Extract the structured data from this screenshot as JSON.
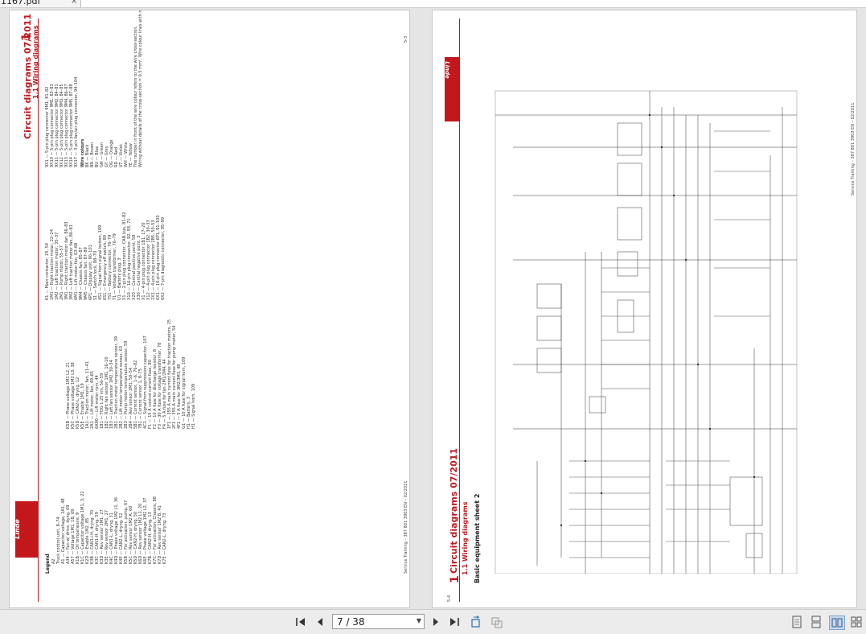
{
  "tab": {
    "title": "1167.pdf",
    "close": "×"
  },
  "left_page": {
    "header": {
      "title": "Circuit diagrams 07/2011",
      "chapter": "1",
      "section": "1.1 Wiring diagrams"
    },
    "legend_title": "Legend",
    "col1": [
      "A2",
      "Truck control unit, 8–74",
      "A1 — Capacitor voltage, 2A1, 48",
      "A34 — Fan w/ drive, dyng. 69",
      "A57 — Voltage 1M1, 1B, 69",
      "K1B — Oil temperature, 9",
      "K1C — Capacitor voltage 1M1, 3, 22",
      "K2D — Enable 1M2, 85",
      "K3B — CAN1+H, dryng. 70",
      "K3C — CAN1-H, dryng. 59",
      "K3D — Rev sensor 2M1, 27",
      "K3E — Rev sensor 2M1, 27",
      "K4C — CAN1-L, dryng. 31",
      "K4D — Phase voltage 1M2 L1, 36",
      "K4E — CAN2-L, dryng. 52",
      "K5B — For activation, pump, 67",
      "K5C — Rev sensor 1M2 A, 60",
      "K5D — CAN2-H, dryng. 50",
      "K6D — Rev sensor 1M2 L1, 20",
      "K6E — Phase voltage 1M2 L2, 37",
      "K7B — CAN2-H, dryng. 13",
      "K7C — For activation, Chassis, 88",
      "K7D — Rev sensor 1M2 B, 41",
      "K7E — CAN2-L, dryng. 73"
    ],
    "col2": [
      "K5B — Phase voltage 1M1 L2, 21",
      "K5C — Phase voltage 1M2 L3, 38",
      "K5D — CAN2-L, dryng. 12",
      "K5E — Enable 1M1, 19",
      "1A1 — Traction motor, fan, 11–41",
      "2A1 — Lift motor, fan, 49–65",
      "6A90 — Lift motor rpm, 44",
      "1B1 — FOG 1.25 km, 56–59",
      "1B2 — Right fan sensor 1M1, 16–20",
      "1B3 — Left fan sensor 1M2, 30–34",
      "2B1 — Traction motor temperature sensor, 39",
      "2B2 — Lift motor temperature sensor, 63",
      "2B3 — Pump motor temperature sensor, 59",
      "2B4 — Rev sensor 2M1, 50–54",
      "5B1 — Current sensor, 1–6, 76–82",
      "7B1 — Current sensor 1, 8–75",
      "4C1 — Signal from suppression capacitor, 107",
      "F1 — 15 A control current fuse, 80",
      "F2 — 10 A fuse for discharge resistor, 8",
      "F3 — 30 A fuse for voltage transformer, 78",
      "F4 — 5 A fuse for fan 2M1/2M4, 44",
      "1F1 — 355 A main current fuse for traction motors, 25",
      "2F1 — 355 A main current fuse for pump motor, 54",
      "4F1 — 5 A fuse for 3M2/3M3, 48",
      "G1 — 10 A fuse for signal horn, 109",
      "H1 — Battery, 3",
      "H1 — Signal horn, 109"
    ],
    "col3": [
      "K1 — Main contactor, 25, 54",
      "1M1 — Right traction motor, 22–24",
      "1M2 — Left traction motor, 35–37",
      "2M1 — Pump motor, 55–57",
      "3M1 — Right traction motor fan, 86–83",
      "3M2 — Left traction motor fan, 86–81",
      "6M1 — Lift motor fan, 63–68",
      "9M4 — Chassis fan, 85–87",
      "9M5 — Chassis fan, 87–89",
      "6P1 — Display unit, 90–101",
      "S1 — Switch lock, 88–70",
      "4S1 — Signal horn signal button, 109",
      "6S1 — Emergency off switch, 80",
      "7S1 — Battery connector, 76–79",
      "T1 — Voltage transformer, 76–79",
      "U1 — Battery plug, 3",
      "X1 — 2-pin plug connector, CAN bus, 81–82",
      "X10 — 16-pin plug connector, 92, 93, 71",
      "X20 — Central positive point, 58",
      "X30 — Central negative point, 3",
      "X1 — 4-pin plug connector 1B1, 17–20",
      "X12 — 4-pin plug connector 1B2, 30–33",
      "2X1 — 4-pin plug connector 2B5, 50–53",
      "6X1 — 10-pin plug connector 6P1, 91–100",
      "6X2 — 7-pin diagnostic connector, 95–99"
    ],
    "col4": [
      "9X1 — 5-pin plug connector 9M1, 81–82",
      "9X10 — 5-pin plug connector 9M1, 83–83",
      "9X11 — 5-pin plug connector 9M2, 84–81",
      "9X12 — 5-pin plug connector 9M3, 84–85",
      "9X13 — 5-pin plug connector 9M4, 86–87",
      "9X14 — 5-pin plug connector 9M5, 87–88",
      "9X17 — 3-pin fan/air plug connector, 94–104",
      "Wire colours",
      "BK — Black",
      "BN — Brown",
      "BU — Blue",
      "GN — Green",
      "GY — Grey",
      "OG — Orange",
      "RD — Red",
      "VT — Violet",
      "WH — White",
      "YE — Yellow",
      "The number in front of the wire colour refers to the wire cross-section.",
      "Wiring without details of the cross-section = 0.5 mm². Wire colour lines with no colour details = BK"
    ],
    "footer_left": "Service Training – 387 801 3903 EN – 02/2011",
    "footer_right": "5-3"
  },
  "right_page": {
    "header": {
      "chapter": "1",
      "title": "Circuit diagrams 07/2011",
      "section": "1.1 Wiring diagrams",
      "subsection": "Basic equipment sheet 2"
    },
    "sheet_label": "Basic equipment sheet 2",
    "footer_left": "5-4",
    "footer_right": "Service Training – 387 801 3903 EN – 02/2011"
  },
  "toolbar": {
    "first_page": "first-page-icon",
    "prev_page": "prev-page-icon",
    "page_value": "7 / 38",
    "next_page": "next-page-icon",
    "last_page": "last-page-icon",
    "rotate_cw": "rotate-icon",
    "rotate_ccw": "rotate-alt-icon",
    "view_single": "single-page-icon",
    "view_continuous": "continuous-page-icon",
    "view_two_page": "two-page-icon",
    "view_grid": "grid-view-icon"
  },
  "colors": {
    "brand_red": "#c4171c",
    "background": "#e5e5e5"
  }
}
